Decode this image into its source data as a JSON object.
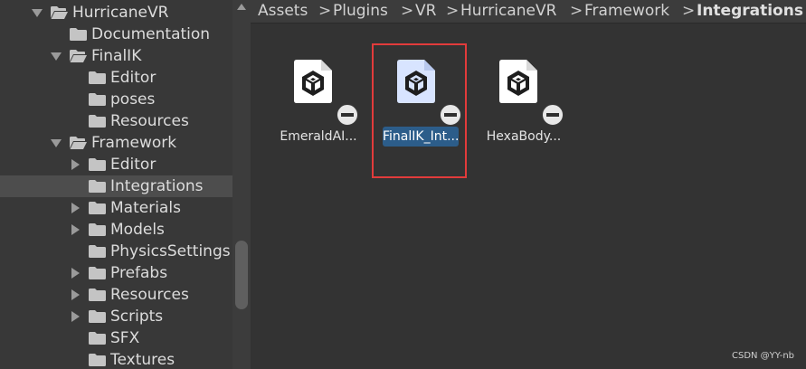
{
  "tree": {
    "rows": [
      {
        "label": "HurricaneVR",
        "expand": "down",
        "selected": false,
        "indent": 0
      },
      {
        "label": "Documentation",
        "expand": "none",
        "selected": false,
        "indent": 1
      },
      {
        "label": "FinalIK",
        "expand": "down",
        "selected": false,
        "indent": 1
      },
      {
        "label": "Editor",
        "expand": "none",
        "selected": false,
        "indent": 2
      },
      {
        "label": "poses",
        "expand": "none",
        "selected": false,
        "indent": 2
      },
      {
        "label": "Resources",
        "expand": "none",
        "selected": false,
        "indent": 2
      },
      {
        "label": "Framework",
        "expand": "down",
        "selected": false,
        "indent": 1
      },
      {
        "label": "Editor",
        "expand": "right",
        "selected": false,
        "indent": 2
      },
      {
        "label": "Integrations",
        "expand": "none",
        "selected": true,
        "indent": 2
      },
      {
        "label": "Materials",
        "expand": "right",
        "selected": false,
        "indent": 2
      },
      {
        "label": "Models",
        "expand": "right",
        "selected": false,
        "indent": 2
      },
      {
        "label": "PhysicsSettings",
        "expand": "none",
        "selected": false,
        "indent": 2
      },
      {
        "label": "Prefabs",
        "expand": "right",
        "selected": false,
        "indent": 2
      },
      {
        "label": "Resources",
        "expand": "right",
        "selected": false,
        "indent": 2
      },
      {
        "label": "Scripts",
        "expand": "right",
        "selected": false,
        "indent": 2
      },
      {
        "label": "SFX",
        "expand": "none",
        "selected": false,
        "indent": 2
      },
      {
        "label": "Textures",
        "expand": "none",
        "selected": false,
        "indent": 2
      }
    ]
  },
  "breadcrumb": {
    "items": [
      "Assets",
      "Plugins",
      "VR",
      "HurricaneVR",
      "Framework",
      "Integrations"
    ],
    "separator": ">"
  },
  "assets": [
    {
      "label": "EmeraldAI...",
      "selected": false,
      "icon": "unity-package-icon"
    },
    {
      "label": "FinalIK_Int...",
      "selected": true,
      "icon": "unity-package-icon"
    },
    {
      "label": "HexaBody...",
      "selected": false,
      "icon": "unity-package-icon"
    }
  ],
  "watermark": "CSDN @YY-nb",
  "colors": {
    "selection_blue": "#2c5d8a",
    "highlight_red": "#e23b3b",
    "tree_selected": "#4d4d4d"
  }
}
